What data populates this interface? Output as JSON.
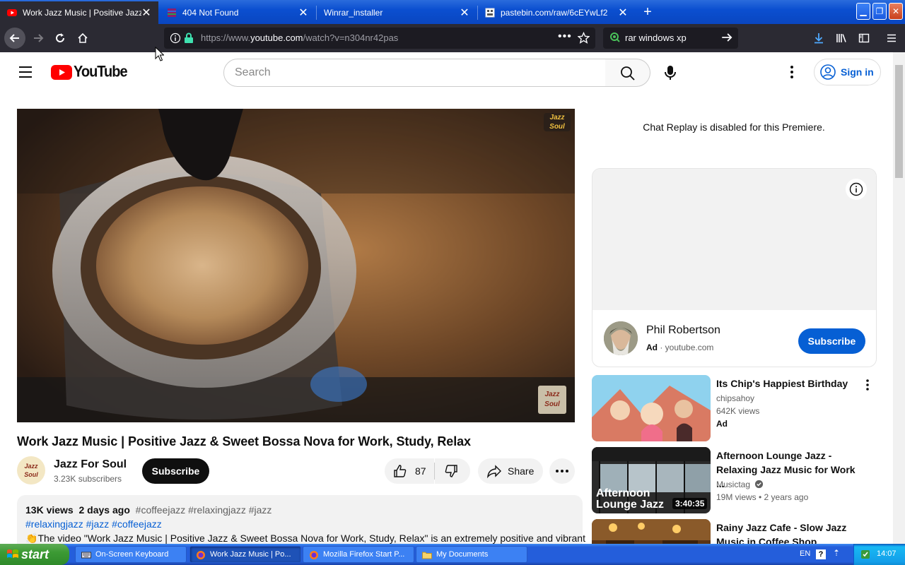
{
  "browser": {
    "tabs": [
      {
        "label": "Work Jazz Music | Positive Jazz & S",
        "active": true,
        "favicon": "youtube-favicon"
      },
      {
        "label": "404 Not Found",
        "active": false,
        "favicon": "winrar-favicon"
      },
      {
        "label": "Winrar_installer",
        "active": false,
        "favicon": "none"
      },
      {
        "label": "pastebin.com/raw/6cEYwLf2",
        "active": false,
        "favicon": "pastebin-favicon"
      }
    ],
    "url_prefix": "https://www.",
    "url_domain": "youtube.com",
    "url_path": "/watch?v=n304nr42pas",
    "search_value": "rar windows xp"
  },
  "yt": {
    "logo_text": "YouTube",
    "search_placeholder": "Search",
    "signin_label": "Sign in",
    "video": {
      "title": "Work Jazz Music | Positive Jazz & Sweet Bossa Nova for Work, Study, Relax",
      "watermark": "Jazz Soul",
      "channel_name": "Jazz For Soul",
      "channel_logo": "Jazz Soul",
      "subscribers": "3.23K subscribers",
      "subscribe_label": "Subscribe",
      "likes": "87",
      "share_label": "Share",
      "views": "13K views",
      "age": "2 days ago",
      "hashtags_line1": "#coffeejazz #relaxingjazz #jazz",
      "hashtags_line2": "#relaxingjazz #jazz #coffeejazz",
      "description": "The video \"Work Jazz Music | Positive Jazz & Sweet Bossa Nova for Work, Study, Relax\" is an extremely positive and vibrant"
    },
    "chat_note": "Chat Replay is disabled for this Premiere.",
    "ad": {
      "name": "Phil Robertson",
      "badge": "Ad",
      "domain": "youtube.com",
      "subscribe_label": "Subscribe"
    },
    "recommendations": [
      {
        "title": "Its Chip's Happiest Birthday",
        "channel": "chipsahoy",
        "meta": "642K views",
        "badge": "Ad",
        "duration": "",
        "thumb_text": ""
      },
      {
        "title": "Afternoon Lounge Jazz - Relaxing Jazz Music for Work ...",
        "channel": "Musictag",
        "meta": "19M views  •  2 years ago",
        "badge": "",
        "duration": "3:40:35",
        "thumb_text": "Afternoon Lounge Jazz"
      },
      {
        "title": "Rainy Jazz Cafe - Slow Jazz Music in Coffee Shop Ambien...",
        "channel": "",
        "meta": "",
        "badge": "",
        "duration": "",
        "thumb_text": ""
      }
    ]
  },
  "taskbar": {
    "start_label": "start",
    "tasks": [
      {
        "label": "On-Screen Keyboard",
        "active": false
      },
      {
        "label": "Work Jazz Music | Po...",
        "active": true
      },
      {
        "label": "Mozilla Firefox Start P...",
        "active": false
      },
      {
        "label": "My Documents",
        "active": false
      }
    ],
    "lang": "EN",
    "clock": "14:07"
  }
}
